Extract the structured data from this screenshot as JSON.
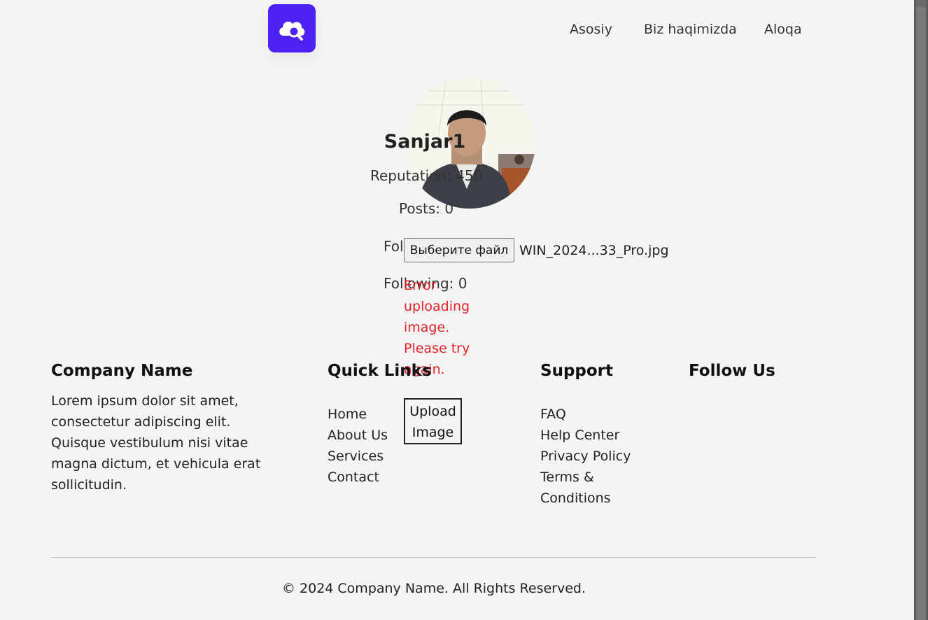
{
  "header": {
    "logo_icon": "cloud-search-icon",
    "nav": [
      "Asosiy",
      "Biz haqimizda",
      "Aloqa"
    ]
  },
  "profile": {
    "username": "Sanjar1",
    "reputation": "Reputation: 450",
    "posts": "Posts: 0",
    "followers": "Followers: 0",
    "following": "Following: 0",
    "file_button": "Выберите файл",
    "file_name": "WIN_2024...33_Pro.jpg",
    "error": "Error uploading image. Please try again.",
    "upload_button": "Upload Image"
  },
  "footer": {
    "company": {
      "heading": "Company Name",
      "text": "Lorem ipsum dolor sit amet, consectetur adipiscing elit. Quisque vestibulum nisi vitae magna dictum, et vehicula erat sollicitudin."
    },
    "quick_links": {
      "heading": "Quick Links",
      "items": [
        "Home",
        "About Us",
        "Services",
        "Contact"
      ]
    },
    "support": {
      "heading": "Support",
      "items": [
        "FAQ",
        "Help Center",
        "Privacy Policy",
        "Terms & Conditions"
      ]
    },
    "follow": {
      "heading": "Follow Us"
    },
    "copyright": "© 2024 Company Name. All Rights Reserved."
  },
  "colors": {
    "brand": "#4c22f2",
    "error": "#e8202a",
    "background": "#f4f4f4"
  }
}
